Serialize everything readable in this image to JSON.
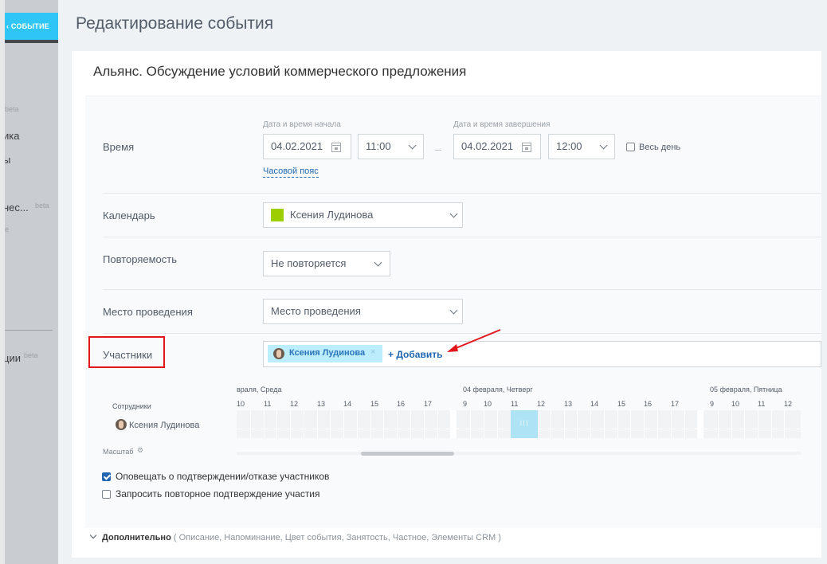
{
  "left_panel": {
    "event_tab": "‹ СОБЫТИЕ",
    "items": [
      {
        "text": "beta",
        "kind": "beta"
      },
      {
        "text": "ика",
        "kind": "text"
      },
      {
        "text": "ы",
        "kind": "text"
      },
      {
        "text": "нес...",
        "kind": "text"
      },
      {
        "text": "beta",
        "kind": "beta"
      },
      {
        "text": "e",
        "kind": "beta"
      },
      {
        "text": "ции",
        "kind": "text"
      },
      {
        "text": "beta",
        "kind": "beta"
      }
    ]
  },
  "page": {
    "title": "Редактирование события",
    "event_name": "Альянс. Обсуждение условий коммерческого предложения"
  },
  "time": {
    "label": "Время",
    "start_label": "Дата и время начала",
    "start_date": "04.02.2021",
    "start_time": "11:00",
    "end_label": "Дата и время завершения",
    "end_date": "04.02.2021",
    "end_time": "12:00",
    "all_day": "Весь день",
    "all_day_checked": false,
    "timezone_link": "Часовой пояс"
  },
  "calendar": {
    "label": "Календарь",
    "value": "Ксения Лудинова",
    "color": "#9dcf00"
  },
  "repeat": {
    "label": "Повторяемость",
    "value": "Не повторяется"
  },
  "location": {
    "label": "Место проведения",
    "placeholder": "Место проведения"
  },
  "attendees": {
    "label": "Участники",
    "tag": "Ксения Лудинова",
    "remove": "×",
    "add": "+ Добавить"
  },
  "planner": {
    "employees_label": "Сотрудники",
    "employee": "Ксения Лудинова",
    "days": [
      "враля, Среда",
      "04 февраля, Четверг",
      "05 февраля, Пятница"
    ],
    "hours_day1": [
      "10",
      "11",
      "12",
      "13",
      "14",
      "15",
      "16",
      "17"
    ],
    "hours_day2": [
      "9",
      "10",
      "11",
      "12",
      "13",
      "14",
      "15",
      "16",
      "17"
    ],
    "hours_day3": [
      "9",
      "10",
      "11",
      "12"
    ],
    "selection_text": "| | |",
    "scale_label": "Масштаб"
  },
  "notify": {
    "option1": "Оповещать о подтверждении/отказе участников",
    "option1_checked": true,
    "option2": "Запросить повторное подтверждение участия",
    "option2_checked": false
  },
  "additional": {
    "label": "Дополнительно",
    "items": "( Описание,  Напоминание,  Цвет события,  Занятость,  Частное,  Элементы CRM )"
  }
}
